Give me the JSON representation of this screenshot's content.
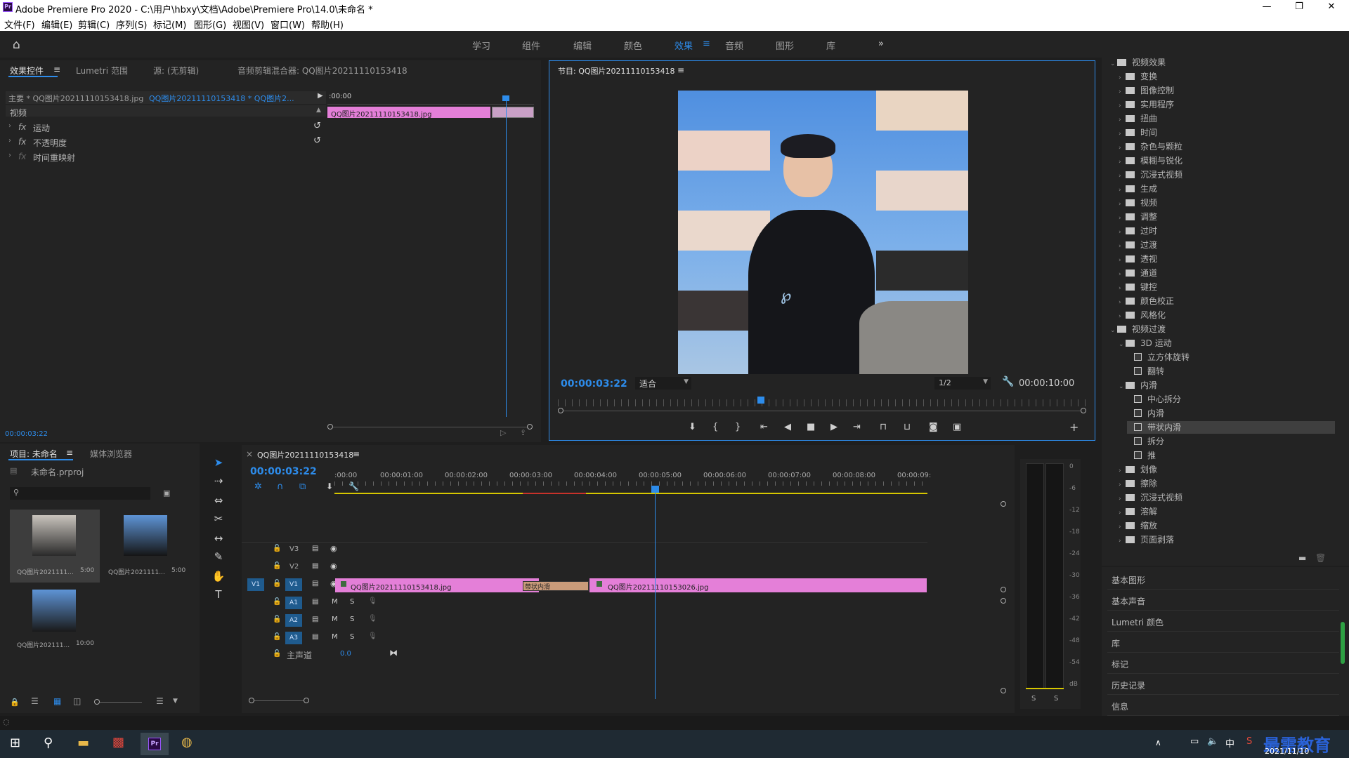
{
  "app": {
    "icon_text": "Pr",
    "title": "Adobe Premiere Pro 2020 - C:\\用户\\hbxy\\文档\\Adobe\\Premiere Pro\\14.0\\未命名 *"
  },
  "menu": [
    "文件(F)",
    "编辑(E)",
    "剪辑(C)",
    "序列(S)",
    "标记(M)",
    "图形(G)",
    "视图(V)",
    "窗口(W)",
    "帮助(H)"
  ],
  "workspaces": [
    "学习",
    "组件",
    "编辑",
    "颜色",
    "效果",
    "音频",
    "图形",
    "库"
  ],
  "active_workspace": "效果",
  "effect_controls": {
    "tabs": [
      "效果控件",
      "Lumetri 范围",
      "源: (无剪辑)",
      "音频剪辑混合器: QQ图片20211110153418"
    ],
    "master": "主要 * QQ图片20211110153418.jpg",
    "sequence": "QQ图片20211110153418 * QQ图片2...",
    "timecode_start": ":00:00",
    "clip_label": "QQ图片20211110153418.jpg",
    "section": "视频",
    "rows": [
      "运动",
      "不透明度",
      "时间重映射"
    ],
    "fx_label": "fx",
    "current_time": "00:00:03:22"
  },
  "program": {
    "title": "节目: QQ图片20211110153418",
    "timecode": "00:00:03:22",
    "fit": "适合",
    "quality": "1/2",
    "duration": "00:00:10:00"
  },
  "project": {
    "tabs": [
      "项目: 未命名",
      "媒体浏览器"
    ],
    "file": "未命名.prproj",
    "items": [
      {
        "name": "QQ图片2021111...",
        "duration": "5:00"
      },
      {
        "name": "QQ图片2021111...",
        "duration": "5:00"
      },
      {
        "name": "QQ图片202111...",
        "duration": "10:00"
      }
    ]
  },
  "timeline": {
    "title": "QQ图片20211110153418",
    "timecode": "00:00:03:22",
    "ruler": [
      ":00:00",
      "00:00:01:00",
      "00:00:02:00",
      "00:00:03:00",
      "00:00:04:00",
      "00:00:05:00",
      "00:00:06:00",
      "00:00:07:00",
      "00:00:08:00",
      "00:00:09:"
    ],
    "video_tracks": [
      "V3",
      "V2",
      "V1"
    ],
    "audio_tracks": [
      "A1",
      "A2",
      "A3"
    ],
    "master": "主声道",
    "master_value": "0.0",
    "clip1": "QQ图片20211110153418.jpg",
    "transition": "带状内滑",
    "clip2": "QQ图片20211110153026.jpg",
    "m_label": "M",
    "s_label": "S"
  },
  "meter": {
    "scale": [
      "0",
      "-6",
      "-12",
      "-18",
      "-24",
      "-30",
      "-36",
      "-42",
      "-48",
      "-54",
      "dB"
    ],
    "solo": [
      "S",
      "S"
    ]
  },
  "effects_tree": {
    "top_partial": "视频效果",
    "video_effects": [
      "变换",
      "图像控制",
      "实用程序",
      "扭曲",
      "时间",
      "杂色与颗粒",
      "模糊与锐化",
      "沉浸式视频",
      "生成",
      "视频",
      "调整",
      "过时",
      "过渡",
      "透视",
      "通道",
      "键控",
      "颜色校正",
      "风格化"
    ],
    "video_transitions": "视频过渡",
    "t3d": "3D 运动",
    "t3d_items": [
      "立方体旋转",
      "翻转"
    ],
    "slide": "内滑",
    "slide_items": [
      "中心拆分",
      "内滑",
      "带状内滑",
      "拆分",
      "推"
    ],
    "more": [
      "划像",
      "擦除",
      "沉浸式视频",
      "溶解",
      "缩放",
      "页面剥落"
    ],
    "selected": "带状内滑"
  },
  "side_panels": [
    "基本图形",
    "基本声音",
    "Lumetri 颜色",
    "库",
    "标记",
    "历史记录",
    "信息"
  ],
  "taskbar": {
    "date": "2021/11/10",
    "watermark": "最需教育",
    "ime": "中"
  }
}
